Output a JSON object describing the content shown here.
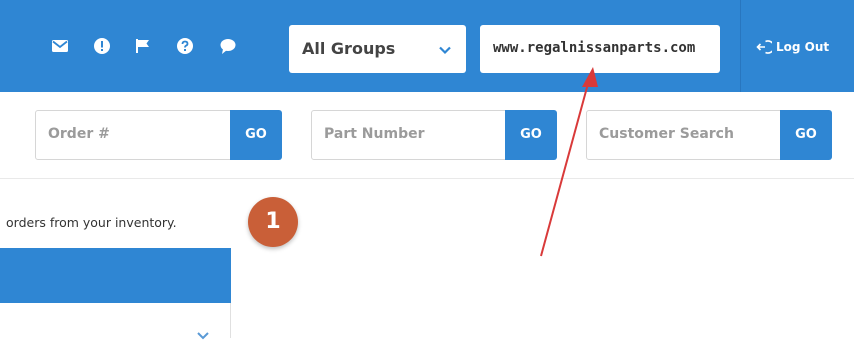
{
  "header": {
    "icons": [
      "envelope-icon",
      "alert-icon",
      "flag-icon",
      "help-icon",
      "chat-bubble-icon"
    ],
    "group_select": {
      "selected": "All Groups",
      "icon": "chevron-down-icon"
    },
    "site_url": "www.regalnissanparts.com",
    "logout_label": "Log Out"
  },
  "search": {
    "order": {
      "placeholder": "Order #",
      "go_label": "GO"
    },
    "part": {
      "placeholder": "Part Number",
      "go_label": "GO"
    },
    "customer": {
      "placeholder": "Customer Search",
      "go_label": "GO"
    }
  },
  "content": {
    "instruction_text": "orders from your inventory.",
    "step_badge": "1"
  },
  "colors": {
    "brand_blue": "#2f86d3",
    "badge_orange": "#c95f38",
    "annotation_arrow": "#d93a3a"
  }
}
